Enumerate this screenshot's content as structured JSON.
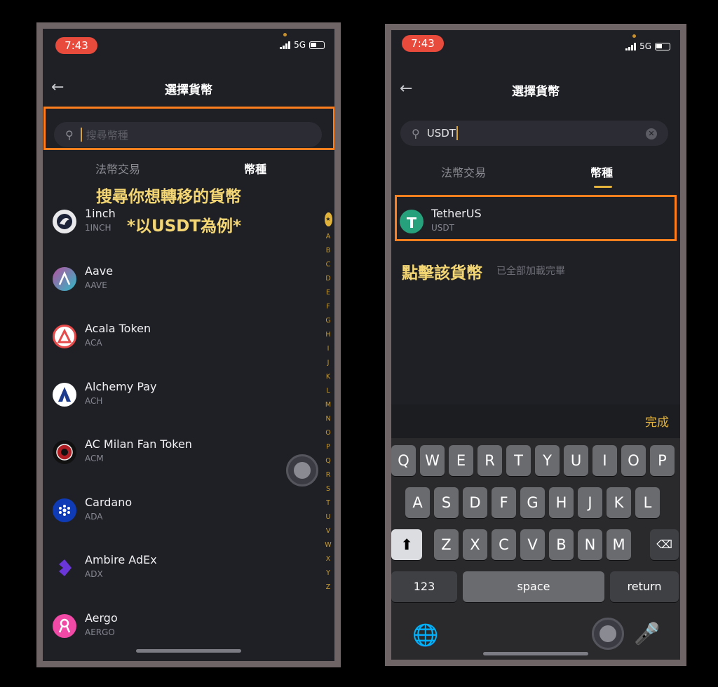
{
  "left": {
    "status": {
      "time": "7:43",
      "network": "5G"
    },
    "title": "選擇貨幣",
    "search": {
      "placeholder": "搜尋幣種"
    },
    "tabs": [
      {
        "label": "法幣交易"
      },
      {
        "label": "幣種"
      }
    ],
    "annotation": {
      "line1": "搜尋你想轉移的貨幣",
      "line2": "*以USDT為例*"
    },
    "coins": [
      {
        "name": "1inch",
        "symbol": "1INCH",
        "color": "#e9e9ec"
      },
      {
        "name": "Aave",
        "symbol": "AAVE",
        "color": "#9aa7d6"
      },
      {
        "name": "Acala Token",
        "symbol": "ACA",
        "color": "#e64a4a"
      },
      {
        "name": "Alchemy Pay",
        "symbol": "ACH",
        "color": "#1c3b8c"
      },
      {
        "name": "AC Milan Fan Token",
        "symbol": "ACM",
        "color": "#222"
      },
      {
        "name": "Cardano",
        "symbol": "ADA",
        "color": "#0f3bb6"
      },
      {
        "name": "Ambire AdEx",
        "symbol": "ADX",
        "color": "#6a36d8"
      },
      {
        "name": "Aergo",
        "symbol": "AERGO",
        "color": "#f04aa6"
      }
    ],
    "index": [
      "A",
      "B",
      "C",
      "D",
      "E",
      "F",
      "G",
      "H",
      "I",
      "J",
      "K",
      "L",
      "M",
      "N",
      "O",
      "P",
      "Q",
      "R",
      "S",
      "T",
      "U",
      "V",
      "W",
      "X",
      "Y",
      "Z"
    ]
  },
  "right": {
    "status": {
      "time": "7:43",
      "network": "5G"
    },
    "title": "選擇貨幣",
    "search": {
      "value": "USDT"
    },
    "tabs": [
      {
        "label": "法幣交易"
      },
      {
        "label": "幣種"
      }
    ],
    "result": {
      "name": "TetherUS",
      "symbol": "USDT",
      "icon_letter": "T",
      "color": "#26a17b"
    },
    "annotation": "點擊該貨幣",
    "loaded_text": "已全部加載完畢",
    "keyboard": {
      "done": "完成",
      "row1": [
        "Q",
        "W",
        "E",
        "R",
        "T",
        "Y",
        "U",
        "I",
        "O",
        "P"
      ],
      "row2": [
        "A",
        "S",
        "D",
        "F",
        "G",
        "H",
        "J",
        "K",
        "L"
      ],
      "row3": [
        "Z",
        "X",
        "C",
        "V",
        "B",
        "N",
        "M"
      ],
      "numbers": "123",
      "space": "space",
      "return": "return"
    }
  }
}
